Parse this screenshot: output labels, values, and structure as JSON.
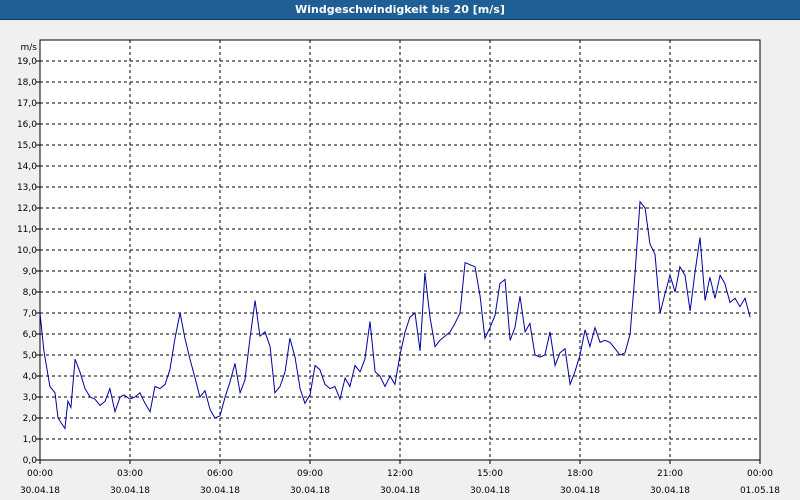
{
  "window": {
    "title": "Windgeschwindigkeit bis 20 [m/s]"
  },
  "colors": {
    "titlebar": "#1f5f96",
    "plot_bg": "#ffffff",
    "line": "#0000a0",
    "grid": "#000000"
  },
  "chart_data": {
    "type": "line",
    "title": "Windgeschwindigkeit bis 20 [m/s]",
    "ylabel": "m/s",
    "xlabel": "",
    "ylim": [
      0,
      20
    ],
    "xlim_hours": [
      0,
      24
    ],
    "grid": true,
    "y_ticks": [
      "0,0",
      "1,0",
      "2,0",
      "3,0",
      "4,0",
      "5,0",
      "6,0",
      "7,0",
      "8,0",
      "9,0",
      "10,0",
      "11,0",
      "12,0",
      "13,0",
      "14,0",
      "15,0",
      "16,0",
      "17,0",
      "18,0",
      "19,0"
    ],
    "x_ticks": [
      {
        "time": "00:00",
        "date": "30.04.18"
      },
      {
        "time": "03:00",
        "date": "30.04.18"
      },
      {
        "time": "06:00",
        "date": "30.04.18"
      },
      {
        "time": "09:00",
        "date": "30.04.18"
      },
      {
        "time": "12:00",
        "date": "30.04.18"
      },
      {
        "time": "15:00",
        "date": "30.04.18"
      },
      {
        "time": "18:00",
        "date": "30.04.18"
      },
      {
        "time": "21:00",
        "date": "30.04.18"
      },
      {
        "time": "00:00",
        "date": "01.05.18"
      }
    ],
    "series": [
      {
        "x_hours": [
          0,
          0.13,
          0.33,
          0.5,
          0.6,
          0.83,
          0.93,
          1.03,
          1.17,
          1.33,
          1.5,
          1.67,
          1.83,
          2.0,
          2.17,
          2.33,
          2.5,
          2.67,
          2.8,
          3.0,
          3.17,
          3.33,
          3.5,
          3.67,
          3.83,
          4.0,
          4.17,
          4.33,
          4.5,
          4.67,
          4.83,
          5.0,
          5.17,
          5.33,
          5.5,
          5.67,
          5.83,
          6.0,
          6.17,
          6.33,
          6.5,
          6.67,
          6.83,
          7.0,
          7.17,
          7.33,
          7.5,
          7.67,
          7.83,
          8.0,
          8.17,
          8.33,
          8.5,
          8.67,
          8.83,
          9.0,
          9.17,
          9.33,
          9.5,
          9.67,
          9.83,
          10.0,
          10.17,
          10.33,
          10.5,
          10.67,
          10.83,
          11.0,
          11.17,
          11.33,
          11.5,
          11.67,
          11.83,
          12.0,
          12.17,
          12.33,
          12.5,
          12.67,
          12.83,
          13.0,
          13.17,
          13.33,
          13.5,
          13.67,
          13.83,
          14.0,
          14.17,
          14.33,
          14.5,
          14.67,
          14.83,
          15.0,
          15.17,
          15.33,
          15.5,
          15.67,
          15.83,
          16.0,
          16.17,
          16.33,
          16.5,
          16.67,
          16.83,
          17.0,
          17.17,
          17.33,
          17.5,
          17.67,
          17.83,
          18.0,
          18.17,
          18.33,
          18.5,
          18.67,
          18.83,
          19.0,
          19.17,
          19.33,
          19.5,
          19.67,
          19.83,
          20.0,
          20.17,
          20.33,
          20.5,
          20.67,
          20.83,
          21.0,
          21.17,
          21.33,
          21.5,
          21.67,
          21.83,
          22.0,
          22.17,
          22.33,
          22.5,
          22.67,
          22.83,
          23.0,
          23.17,
          23.33,
          23.5,
          23.67,
          23.83,
          24.0
        ],
        "values": [
          7.0,
          5.2,
          3.5,
          3.2,
          2.0,
          1.5,
          2.8,
          2.5,
          4.8,
          4.2,
          3.4,
          3.0,
          2.9,
          2.6,
          2.8,
          3.4,
          2.3,
          3.0,
          3.1,
          2.9,
          3.0,
          3.2,
          2.7,
          2.3,
          3.5,
          3.4,
          3.6,
          4.3,
          5.8,
          7.0,
          5.8,
          4.8,
          3.9,
          3.0,
          3.3,
          2.4,
          2.0,
          2.1,
          3.0,
          3.7,
          4.6,
          3.2,
          3.8,
          5.8,
          7.6,
          5.9,
          6.1,
          5.4,
          3.2,
          3.5,
          4.2,
          5.8,
          4.9,
          3.4,
          2.7,
          3.1,
          4.5,
          4.3,
          3.6,
          3.4,
          3.5,
          2.9,
          3.9,
          3.5,
          4.5,
          4.2,
          4.8,
          6.6,
          4.2,
          4.0,
          3.5,
          4.0,
          3.6,
          5.0,
          6.1,
          6.8,
          7.0,
          5.2,
          8.9,
          6.8,
          5.4,
          5.7,
          5.9,
          6.1,
          6.5,
          7.0,
          9.4,
          9.3,
          9.2,
          7.8,
          5.8,
          6.3,
          6.9,
          8.4,
          8.6,
          5.7,
          6.3,
          7.8,
          6.1,
          6.5,
          5.0,
          4.9,
          5.0,
          6.1,
          4.5,
          5.1,
          5.3,
          3.6,
          4.2,
          5.0,
          6.2,
          5.4,
          6.3,
          5.6,
          5.7,
          5.6,
          5.3,
          5.0,
          5.1,
          6.0,
          8.8,
          12.3,
          12.0,
          10.3,
          9.8,
          7.0,
          7.9,
          8.8,
          8.0,
          9.2,
          8.8,
          7.1,
          8.9,
          10.6,
          7.6,
          8.7,
          7.7,
          8.8,
          8.4,
          7.5,
          7.7,
          7.3,
          7.7,
          6.8
        ]
      }
    ]
  }
}
